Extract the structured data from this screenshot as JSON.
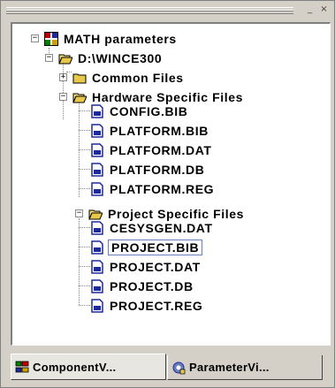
{
  "window": {
    "minimize_glyph": "_",
    "close_glyph": "×"
  },
  "tree": {
    "root": {
      "label": "MATH parameters",
      "icon": "component-icon",
      "expander": "−"
    },
    "build_dir": {
      "label": "D:\\WINCE300",
      "icon": "open-folder-icon",
      "expander": "−"
    },
    "common_files": {
      "label": "Common Files",
      "icon": "folder-icon",
      "expander": "+"
    },
    "hardware_files": {
      "label": "Hardware Specific Files",
      "icon": "open-folder-icon",
      "expander": "−"
    },
    "hardware_items": [
      {
        "label": "CONFIG.BIB",
        "icon": "file-icon"
      },
      {
        "label": "PLATFORM.BIB",
        "icon": "file-icon"
      },
      {
        "label": "PLATFORM.DAT",
        "icon": "file-icon"
      },
      {
        "label": "PLATFORM.DB",
        "icon": "file-icon"
      },
      {
        "label": "PLATFORM.REG",
        "icon": "file-icon"
      }
    ],
    "project_files": {
      "label": "Project Specific Files",
      "icon": "open-folder-icon",
      "expander": "−"
    },
    "project_items": [
      {
        "label": "CESYSGEN.DAT",
        "icon": "file-icon"
      },
      {
        "label": "PROJECT.BIB",
        "icon": "file-icon",
        "selected": true
      },
      {
        "label": "PROJECT.DAT",
        "icon": "file-icon"
      },
      {
        "label": "PROJECT.DB",
        "icon": "file-icon"
      },
      {
        "label": "PROJECT.REG",
        "icon": "file-icon"
      }
    ]
  },
  "tabs": [
    {
      "label": "ComponentV...",
      "icon": "component-view-icon",
      "active": true
    },
    {
      "label": "ParameterVi...",
      "icon": "parameter-view-icon",
      "active": false
    }
  ],
  "colors": {
    "folder": "#e8c84a",
    "file_blue": "#1e2a9c",
    "selection_border": "#6a7fb8"
  }
}
